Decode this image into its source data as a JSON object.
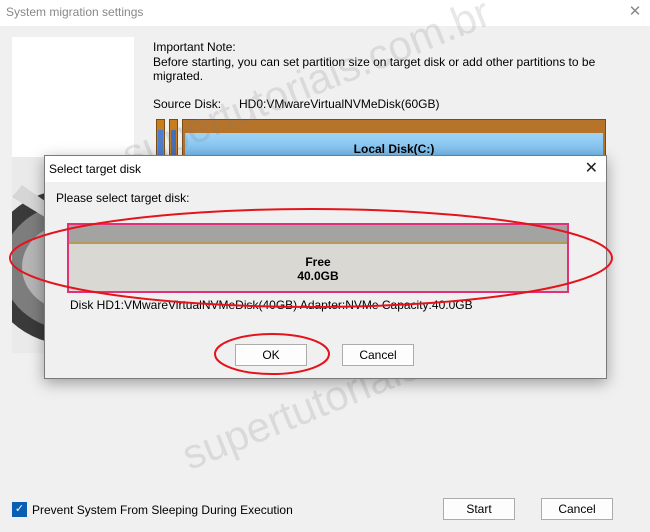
{
  "window": {
    "title": "System migration settings",
    "close_glyph": "✕"
  },
  "note": {
    "title": "Important Note:",
    "text": "Before starting, you can set partition size on target disk or add other partitions to be migrated."
  },
  "source": {
    "label": "Source Disk:",
    "value": "HD0:VMwareVirtualNVMeDisk(60GB)",
    "main_partition": "Local Disk(C:)"
  },
  "footer": {
    "sleep_checkbox_label": "Prevent System From Sleeping During Execution",
    "sleep_checked": true,
    "start_button": "Start",
    "cancel_button": "Cancel"
  },
  "dialog": {
    "title": "Select target disk",
    "close_glyph": "✕",
    "prompt": "Please select target disk:",
    "partition_label": "Free",
    "partition_size": "40.0GB",
    "disk_info": "Disk HD1:VMwareVirtualNVMeDisk(40GB)  Adapter:NVMe  Capacity:40.0GB",
    "ok_button": "OK",
    "cancel_button": "Cancel"
  },
  "watermark": "supertutoriais.com.br",
  "colors": {
    "annotation_red": "#e3141c",
    "selection_pink": "#e0317a",
    "partition_blue": "#6fb6ea",
    "checkbox_blue": "#0a5fb4"
  }
}
